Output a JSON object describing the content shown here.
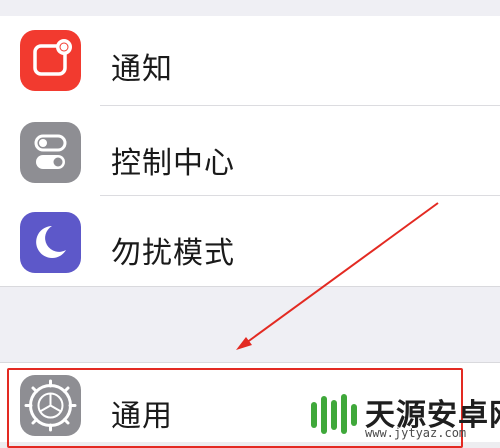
{
  "settings": {
    "items": [
      {
        "label": "通知",
        "icon": "notifications-icon",
        "color": "#f23a2f"
      },
      {
        "label": "控制中心",
        "icon": "control-center-icon",
        "color": "#8e8e93"
      },
      {
        "label": "勿扰模式",
        "icon": "do-not-disturb-moon-icon",
        "color": "#5d58c9"
      },
      {
        "label": "通用",
        "icon": "gear-icon",
        "color": "#8e8e93"
      }
    ]
  },
  "annotation": {
    "highlight_color": "#e32a22",
    "arrow_color": "#e32a22"
  },
  "watermark": {
    "text": "天源安卓网",
    "url": "www.jytyaz.com",
    "logo_color": "#3fa83a"
  }
}
